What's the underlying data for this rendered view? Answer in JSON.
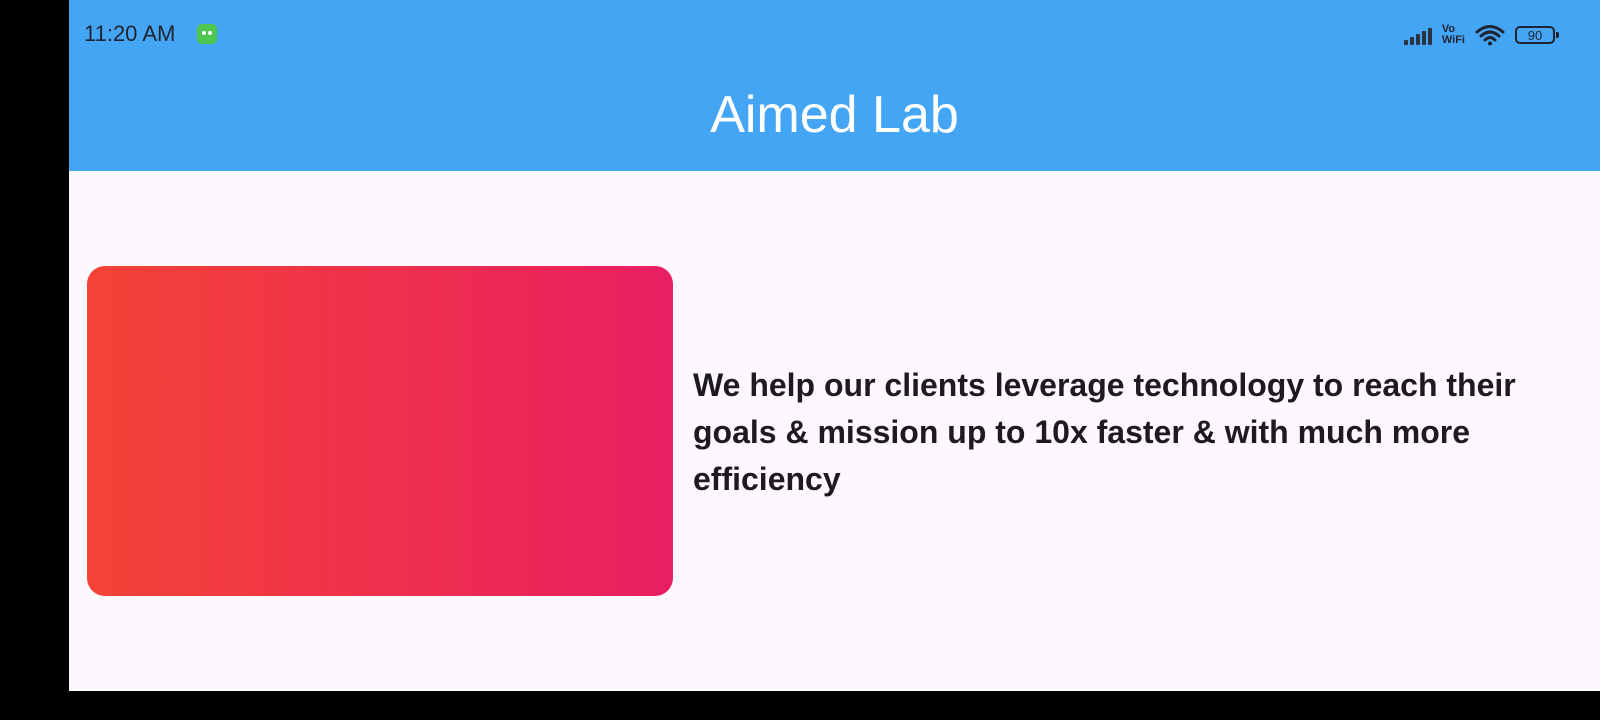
{
  "status_bar": {
    "time": "11:20 AM",
    "network_label_top": "Vo",
    "network_label_bottom": "WiFi",
    "battery_level": "90",
    "icons": [
      "app-notification-icon",
      "signal-icon",
      "wifi-icon",
      "battery-icon"
    ]
  },
  "app_bar": {
    "title": "Aimed Lab",
    "color": "#45A5F5"
  },
  "main": {
    "tagline": "We help our clients leverage technology to reach their goals & mission up to 10x faster & with much more efficiency",
    "card_gradient": [
      "#F44336",
      "#E91E63"
    ]
  }
}
